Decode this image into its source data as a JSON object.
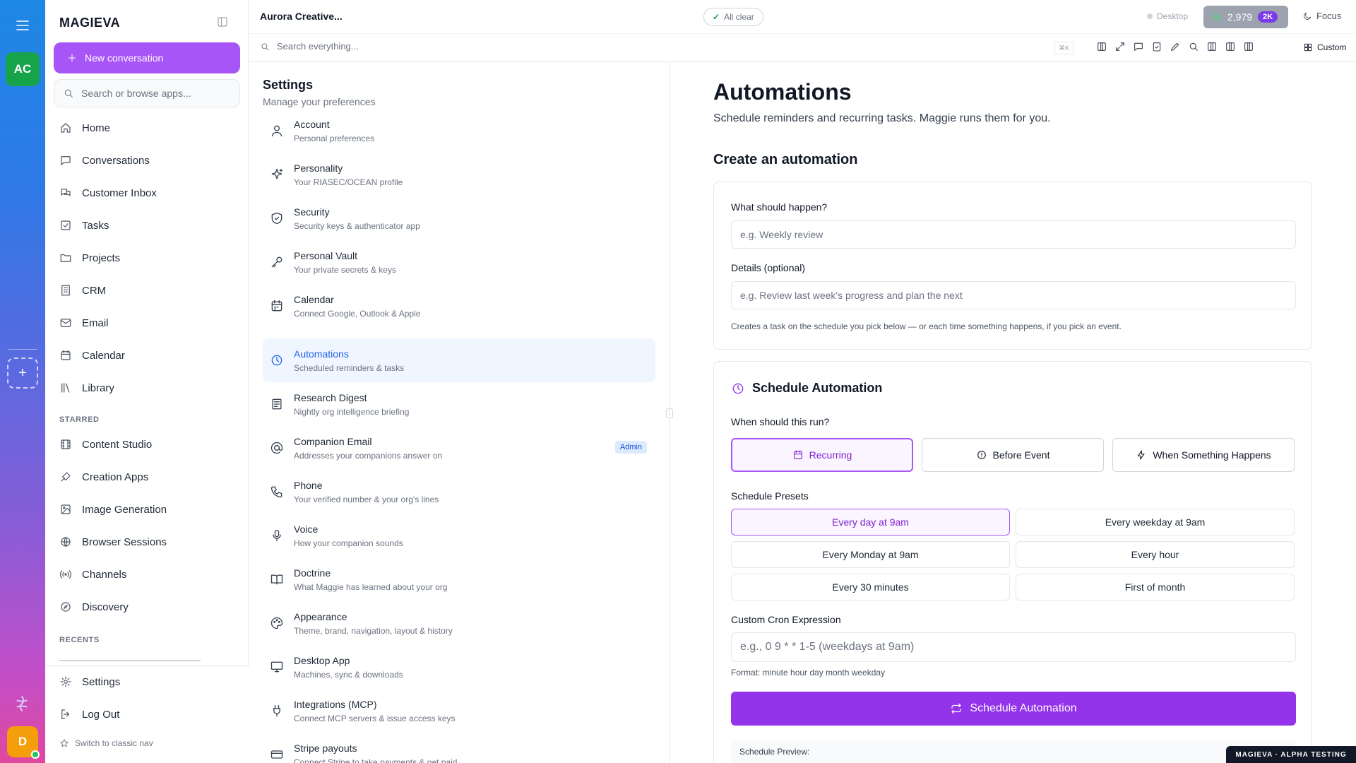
{
  "rail": {
    "avatar": "AC",
    "add": "+",
    "user": "D"
  },
  "nav": {
    "brand": "MAGIEVA",
    "new_conversation": "New conversation",
    "search_placeholder": "Search or browse apps...",
    "main_items": [
      {
        "label": "Home",
        "icon": "home-icon"
      },
      {
        "label": "Conversations",
        "icon": "chat-icon"
      },
      {
        "label": "Customer Inbox",
        "icon": "inbox-icon"
      },
      {
        "label": "Tasks",
        "icon": "task-icon"
      },
      {
        "label": "Projects",
        "icon": "folder-icon"
      },
      {
        "label": "CRM",
        "icon": "building-icon"
      },
      {
        "label": "Email",
        "icon": "mail-icon"
      },
      {
        "label": "Calendar",
        "icon": "calendar-icon"
      },
      {
        "label": "Library",
        "icon": "library-icon"
      }
    ],
    "starred_heading": "STARRED",
    "starred_items": [
      {
        "label": "Content Studio",
        "icon": "film-icon"
      },
      {
        "label": "Creation Apps",
        "icon": "apps-icon"
      },
      {
        "label": "Image Generation",
        "icon": "image-icon"
      },
      {
        "label": "Browser Sessions",
        "icon": "globe-icon"
      },
      {
        "label": "Channels",
        "icon": "broadcast-icon"
      },
      {
        "label": "Discovery",
        "icon": "compass-icon"
      }
    ],
    "recents_heading": "RECENTS",
    "settings": "Settings",
    "logout": "Log Out",
    "switch_nav": "Switch to classic nav"
  },
  "topbar": {
    "title": "Aurora Creative...",
    "status": "All clear",
    "status_check": "✓",
    "desktop": "Desktop",
    "credits": "2,979",
    "credits_badge": "2K",
    "focus": "Focus"
  },
  "searchbar": {
    "placeholder": "Search everything...",
    "shortcut": "⌘K",
    "custom": "Custom"
  },
  "settings": {
    "title": "Settings",
    "subtitle": "Manage your preferences",
    "items": [
      {
        "title": "Account",
        "desc": "Personal preferences",
        "icon": "user-icon"
      },
      {
        "title": "Personality",
        "desc": "Your RIASEC/OCEAN profile",
        "icon": "sparkles-icon"
      },
      {
        "title": "Security",
        "desc": "Security keys & authenticator app",
        "icon": "shield-icon"
      },
      {
        "title": "Personal Vault",
        "desc": "Your private secrets & keys",
        "icon": "key-icon"
      },
      {
        "title": "Calendar",
        "desc": "Connect Google, Outlook & Apple",
        "icon": "calendar-icon"
      },
      {
        "title": "Automations",
        "desc": "Scheduled reminders & tasks",
        "icon": "clock-icon"
      },
      {
        "title": "Research Digest",
        "desc": "Nightly org intelligence briefing",
        "icon": "newspaper-icon"
      },
      {
        "title": "Companion Email",
        "desc": "Addresses your companions answer on",
        "icon": "at-icon",
        "badge": "Admin"
      },
      {
        "title": "Phone",
        "desc": "Your verified number & your org's lines",
        "icon": "phone-icon"
      },
      {
        "title": "Voice",
        "desc": "How your companion sounds",
        "icon": "mic-icon"
      },
      {
        "title": "Doctrine",
        "desc": "What Maggie has learned about your org",
        "icon": "book-icon"
      },
      {
        "title": "Appearance",
        "desc": "Theme, brand, navigation, layout & history",
        "icon": "palette-icon"
      },
      {
        "title": "Desktop App",
        "desc": "Machines, sync & downloads",
        "icon": "monitor-icon"
      },
      {
        "title": "Integrations (MCP)",
        "desc": "Connect MCP servers & issue access keys",
        "icon": "plug-icon"
      },
      {
        "title": "Stripe payouts",
        "desc": "Connect Stripe to take payments & get paid",
        "icon": "card-icon"
      }
    ]
  },
  "main": {
    "title": "Automations",
    "lead": "Schedule reminders and recurring tasks. Maggie runs them for you.",
    "create_heading": "Create an automation",
    "what_label": "What should happen?",
    "what_placeholder": "e.g. Weekly review",
    "details_label": "Details (optional)",
    "details_placeholder": "e.g. Review last week's progress and plan the next",
    "help": "Creates a task on the schedule you pick below — or each time something happens, if you pick an event.",
    "schedule_heading": "Schedule Automation",
    "when_label": "When should this run?",
    "modes": [
      "Recurring",
      "Before Event",
      "When Something Happens"
    ],
    "presets_label": "Schedule Presets",
    "presets": [
      "Every day at 9am",
      "Every weekday at 9am",
      "Every Monday at 9am",
      "Every hour",
      "Every 30 minutes",
      "First of month"
    ],
    "cron_label": "Custom Cron Expression",
    "cron_placeholder": "e.g., 0 9 * * 1-5 (weekdays at 9am)",
    "cron_help": "Format: minute hour day month weekday",
    "submit": "Schedule Automation",
    "preview_label": "Schedule Preview:"
  },
  "footer_badge": "MAGIEVA · ALPHA TESTING",
  "colors": {
    "accent": "#9333ea",
    "active_blue": "#2563eb",
    "success": "#16a34a"
  }
}
